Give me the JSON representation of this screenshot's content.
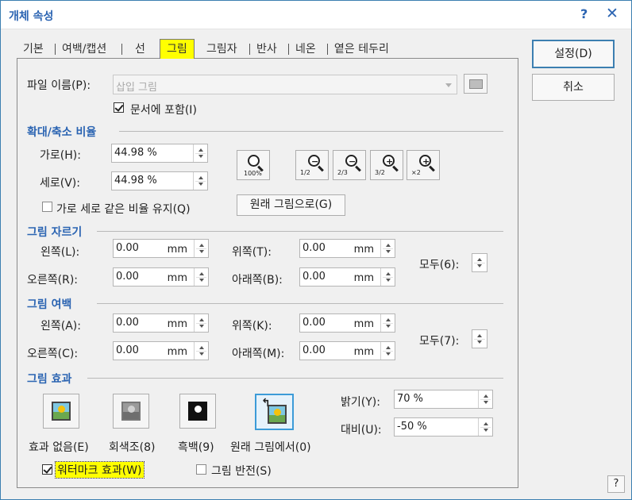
{
  "title": "개체 속성",
  "titlebar": {
    "help_glyph": "?",
    "close_glyph": "✕"
  },
  "tabs": [
    {
      "label": "기본",
      "active": false
    },
    {
      "label": "여백/캡션",
      "active": false
    },
    {
      "label": "선",
      "active": false
    },
    {
      "label": "그림",
      "active": true
    },
    {
      "label": "그림자",
      "active": false
    },
    {
      "label": "반사",
      "active": false
    },
    {
      "label": "네온",
      "active": false
    },
    {
      "label": "옅은 테두리",
      "active": false
    }
  ],
  "buttons": {
    "ok": "설정(D)",
    "cancel": "취소",
    "corner_help": "?"
  },
  "file": {
    "label": "파일 이름(P):",
    "placeholder": "삽입 그림",
    "include_label": "문서에 포함(I)",
    "include_checked": true
  },
  "scale": {
    "title": "확대/축소 비율",
    "width_label": "가로(H):",
    "width_value": "44.98 %",
    "height_label": "세로(V):",
    "height_value": "44.98 %",
    "keep_ratio_label": "가로 세로 같은 비율 유지(Q)",
    "keep_ratio_checked": false,
    "original_button": "원래 그림으로(G)",
    "zoom_icons": [
      "zoom-100-icon",
      "zoom-out-half-icon",
      "zoom-out-two-thirds-icon",
      "zoom-in-three-halves-icon",
      "zoom-in-double-icon"
    ],
    "zoom_labels": [
      "100%",
      "1/2",
      "2/3",
      "3/2",
      "×2"
    ]
  },
  "crop": {
    "title": "그림 자르기",
    "left_label": "왼쪽(L):",
    "left_value": "0.00",
    "right_label": "오른쪽(R):",
    "right_value": "0.00",
    "top_label": "위쪽(T):",
    "top_value": "0.00",
    "bottom_label": "아래쪽(B):",
    "bottom_value": "0.00",
    "all_label": "모두(6):",
    "unit": "mm"
  },
  "margin": {
    "title": "그림 여백",
    "left_label": "왼쪽(A):",
    "left_value": "0.00",
    "right_label": "오른쪽(C):",
    "right_value": "0.00",
    "top_label": "위쪽(K):",
    "top_value": "0.00",
    "bottom_label": "아래쪽(M):",
    "bottom_value": "0.00",
    "all_label": "모두(7):",
    "unit": "mm"
  },
  "effects": {
    "title": "그림 효과",
    "none_label": "효과 없음(E)",
    "gray_label": "회색조(8)",
    "bw_label": "흑백(9)",
    "original_label": "원래 그림에서(0)",
    "selected": "original",
    "brightness_label": "밝기(Y):",
    "brightness_value": "70 %",
    "contrast_label": "대비(U):",
    "contrast_value": "-50 %",
    "watermark_label": "워터마크 효과(W)",
    "watermark_checked": true,
    "invert_label": "그림 반전(S)",
    "invert_checked": false
  },
  "colors": {
    "accent": "#2b64b2",
    "tab_highlight": "#ffff00",
    "selection_border": "#3c9bd8"
  }
}
